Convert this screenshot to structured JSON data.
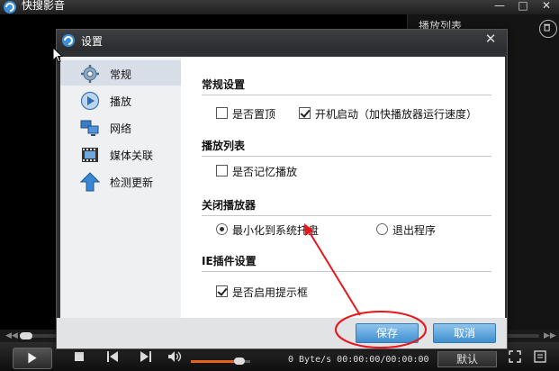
{
  "app": {
    "title": "快搜影音"
  },
  "side_panel": {
    "tab_label": "播放列表"
  },
  "controls": {
    "time_readout": "0 Byte/s 00:00:00/00:00:00",
    "default_label": "默认",
    "volume_level": 0.82
  },
  "dialog": {
    "title": "设置",
    "nav": [
      {
        "label": "常规",
        "icon": "gear-icon",
        "active": true
      },
      {
        "label": "播放",
        "icon": "play-circle-icon",
        "active": false
      },
      {
        "label": "网络",
        "icon": "network-icon",
        "active": false
      },
      {
        "label": "媒体关联",
        "icon": "film-icon",
        "active": false
      },
      {
        "label": "检测更新",
        "icon": "upload-arrow-icon",
        "active": false
      }
    ],
    "sections": {
      "general": {
        "title": "常规设置",
        "always_on_top": {
          "label": "是否置顶",
          "checked": false
        },
        "startup": {
          "label": "开机启动（加快播放器运行速度）",
          "checked": true
        }
      },
      "playlist": {
        "title": "播放列表",
        "remember": {
          "label": "是否记忆播放",
          "checked": false
        }
      },
      "close": {
        "title": "关闭播放器",
        "minimize": {
          "label": "最小化到系统托盘",
          "selected": true
        },
        "exit": {
          "label": "退出程序",
          "selected": false
        }
      },
      "ie_plugin": {
        "title": "IE插件设置",
        "tips": {
          "label": "是否启用提示框",
          "checked": true
        }
      }
    },
    "save_label": "保存",
    "cancel_label": "取消"
  },
  "colors": {
    "accent_blue": "#3f8fd0",
    "annotation_red": "#e8151b",
    "volume_orange": "#e8621e"
  }
}
